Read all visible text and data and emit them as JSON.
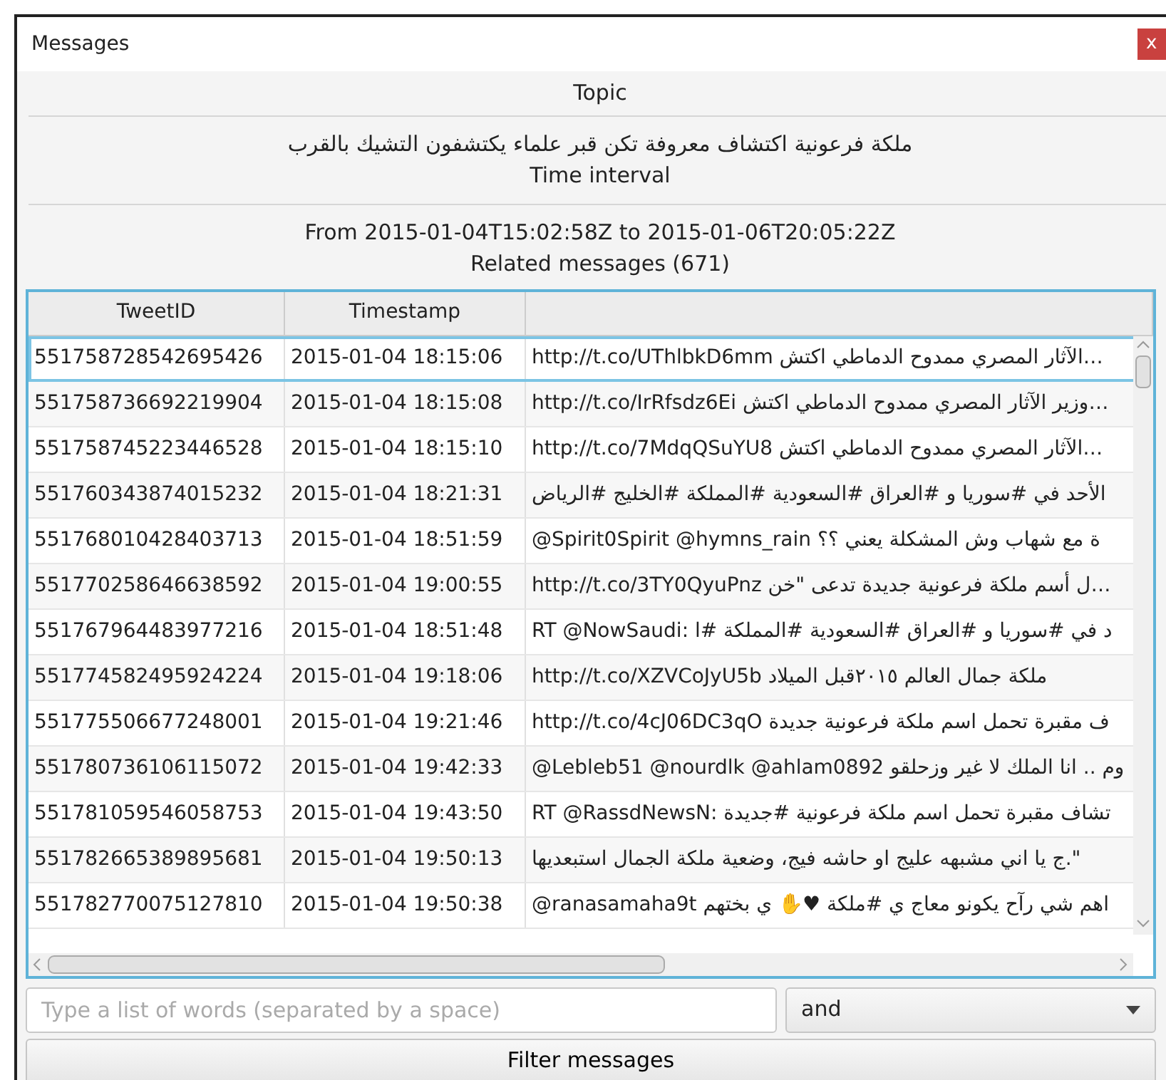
{
  "window": {
    "title": "Messages",
    "close": "x"
  },
  "topic": {
    "label": "Topic",
    "value": "ملكة فرعونية اكتشاف معروفة تكن قبر علماء يكتشفون التشيك بالقرب"
  },
  "interval": {
    "label": "Time interval",
    "value": "From 2015-01-04T15:02:58Z to 2015-01-06T20:05:22Z"
  },
  "related": {
    "label": "Related messages (671)"
  },
  "table": {
    "columns": [
      "TweetID",
      "Timestamp"
    ],
    "rows": [
      {
        "id": "551758728542695426",
        "time": "2015-01-04 18:15:06",
        "text": "http://t.co/UThlbkD6mm الآثار المصري ممدوح الدماطي اكتش…",
        "selected": true
      },
      {
        "id": "551758736692219904",
        "time": "2015-01-04 18:15:08",
        "text": "http://t.co/IrRfsdz6Ei وزير الآثار المصري ممدوح الدماطي اكتش…",
        "selected": false
      },
      {
        "id": "551758745223446528",
        "time": "2015-01-04 18:15:10",
        "text": "http://t.co/7MdqQSuYU8 الآثار المصري ممدوح الدماطي اكتش…",
        "selected": false
      },
      {
        "id": "551760343874015232",
        "time": "2015-01-04 18:21:31",
        "text": "الأحد في #سوريا و #العراق #السعودية #المملكة #الخليج #الرياض",
        "selected": false
      },
      {
        "id": "551768010428403713",
        "time": "2015-01-04 18:51:59",
        "text": "@Spirit0Spirit @hymns_rain ة مع شهاب وش المشكلة يعني ؟؟",
        "selected": false
      },
      {
        "id": "551770258646638592",
        "time": "2015-01-04 19:00:55",
        "text": "http://t.co/3TY0QyuPnz ل أسم ملكة فرعونية جديدة تدعى \"خن…",
        "selected": false
      },
      {
        "id": "551767964483977216",
        "time": "2015-01-04 18:51:48",
        "text": "RT @NowSaudi: د في #سوريا و #العراق #السعودية #المملكة #ا",
        "selected": false
      },
      {
        "id": "551774582495924224",
        "time": "2015-01-04 19:18:06",
        "text": "http://t.co/XZVCoJyU5b ملكة جمال العالم ٢٠١٥قبل الميلاد",
        "selected": false
      },
      {
        "id": "551775506677248001",
        "time": "2015-01-04 19:21:46",
        "text": "http://t.co/4cJ06DC3qO ف مقبرة تحمل اسم ملكة فرعونية جديدة",
        "selected": false
      },
      {
        "id": "551780736106115072",
        "time": "2015-01-04 19:42:33",
        "text": "@Lebleb51 @nourdlk @ahlam0892 وم .. انا الملك لا غير وزحلقو",
        "selected": false
      },
      {
        "id": "551781059546058753",
        "time": "2015-01-04 19:43:50",
        "text": "RT @RassdNewsN: تشاف مقبرة تحمل اسم ملكة فرعونية #جديدة",
        "selected": false
      },
      {
        "id": "551782665389895681",
        "time": "2015-01-04 19:50:13",
        "text": "ج يا اني مشبهه عليج او حاشه فيج، وضعية ملكة الجمال استبعديها.\"",
        "selected": false
      },
      {
        "id": "551782770075127810",
        "time": "2015-01-04 19:50:38",
        "text": "@ranasamaha9t اهم شي رآح يكونو معاج ي #ملكة ♥✋ ي بختهم",
        "selected": false
      }
    ]
  },
  "filter": {
    "placeholder": "Type a list of words (separated by a space)",
    "operator": "and",
    "button": "Filter messages"
  }
}
